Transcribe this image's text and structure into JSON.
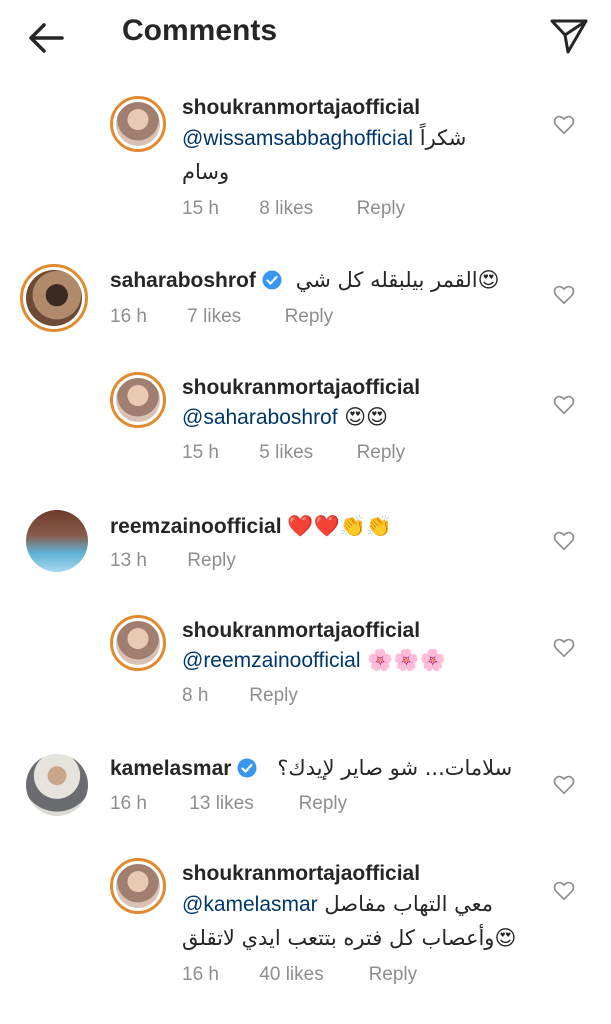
{
  "header": {
    "title": "Comments",
    "back_icon": "arrow-left-icon",
    "send_icon": "paper-plane-icon"
  },
  "comments": [
    {
      "user": "shoukranmortajaofficial",
      "mention": "@wissamsabbaghofficial",
      "text1": "شكراً",
      "text2": "وسام",
      "time": "15 h",
      "likes": "8 likes",
      "reply": "Reply"
    },
    {
      "user": "saharaboshrof",
      "verified": true,
      "text": "😍القمر بيلبقله كل شي",
      "time": "16 h",
      "likes": "7 likes",
      "reply": "Reply"
    },
    {
      "user": "shoukranmortajaofficial",
      "mention": "@saharaboshrof",
      "emoji": "😍😍",
      "time": "15 h",
      "likes": "5 likes",
      "reply": "Reply"
    },
    {
      "user": "reemzainoofficial",
      "emoji": "❤️❤️👏👏",
      "time": "13 h",
      "reply": "Reply"
    },
    {
      "user": "shoukranmortajaofficial",
      "mention": "@reemzainoofficial",
      "emoji": "🌸🌸🌸",
      "time": "8 h",
      "reply": "Reply"
    },
    {
      "user": "kamelasmar",
      "verified": true,
      "text": "سلامات... شو صاير لإيدك؟",
      "time": "16 h",
      "likes": "13 likes",
      "reply": "Reply"
    },
    {
      "user": "shoukranmortajaofficial",
      "mention": "@kamelasmar",
      "text1": "معي التهاب مفاصل",
      "text2": "😍وأعصاب كل فتره بتتعب ايدي لاتقلق",
      "time": "16 h",
      "likes": "40 likes",
      "reply": "Reply"
    }
  ],
  "colors": {
    "mention": "#00376b",
    "meta": "#8e8e8e",
    "ring": "#e08b2f",
    "verified": "#3897f0"
  }
}
